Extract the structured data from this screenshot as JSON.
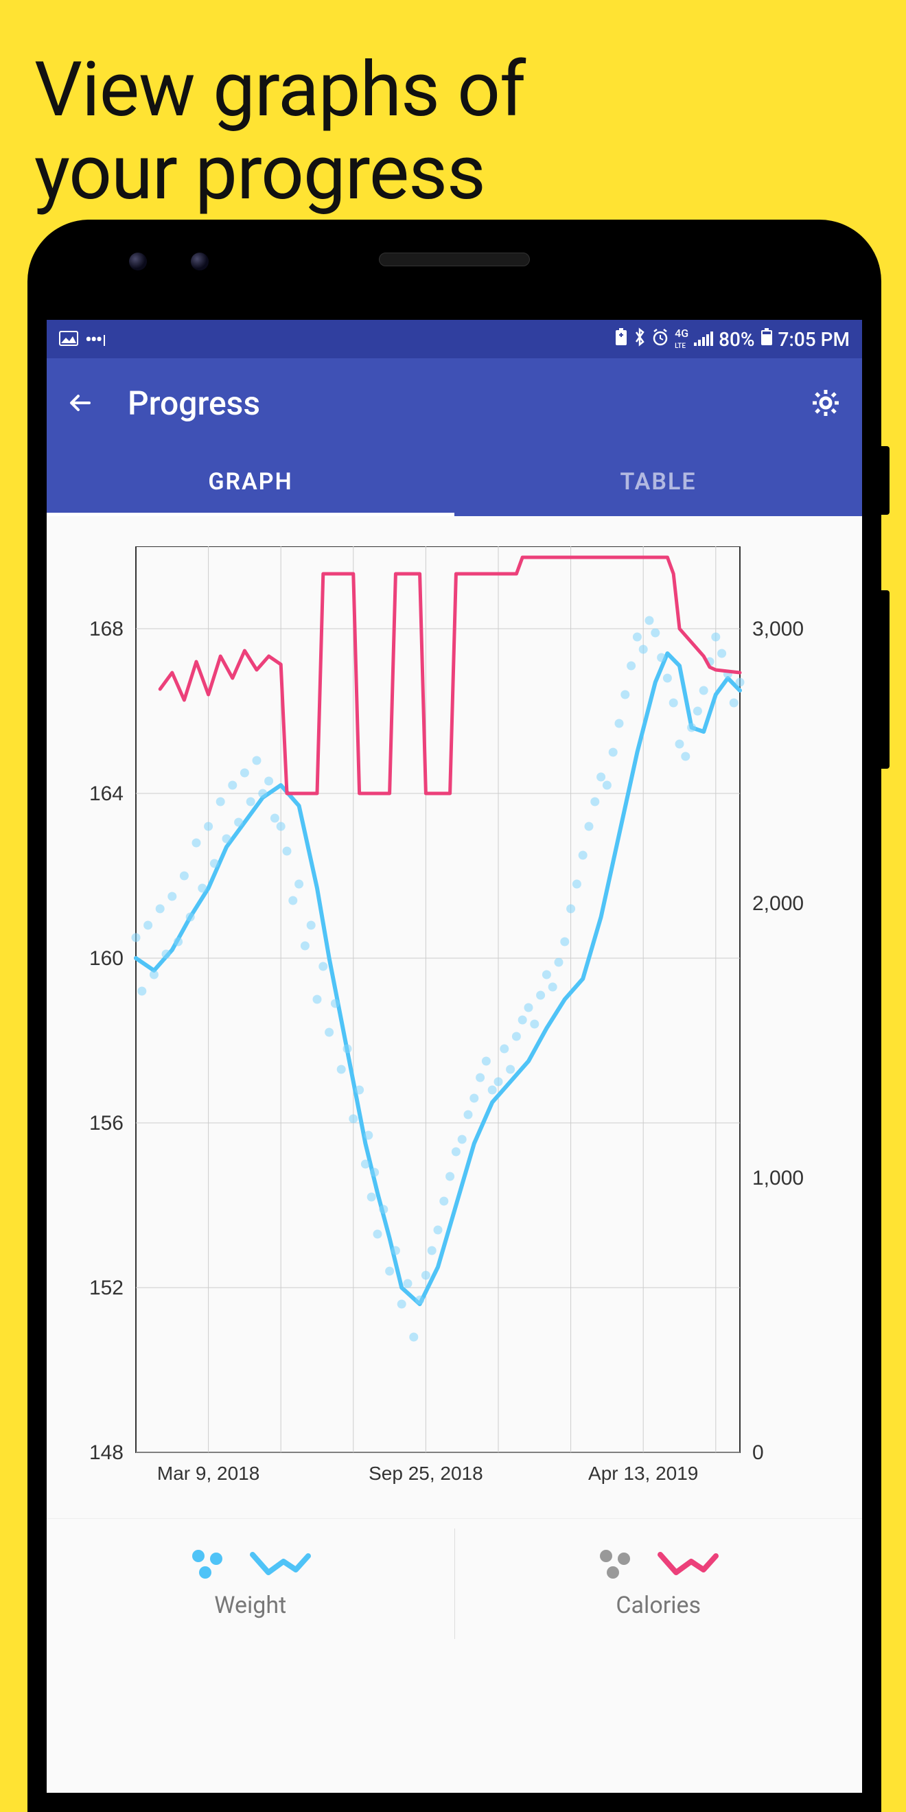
{
  "promo": {
    "line1": "View graphs of",
    "line2": "your progress"
  },
  "status_bar": {
    "battery_pct": "80%",
    "time": "7:05 PM"
  },
  "app_bar": {
    "title": "Progress"
  },
  "tabs": {
    "graph": "GRAPH",
    "table": "TABLE"
  },
  "legend": {
    "weight_label": "Weight",
    "calories_label": "Calories"
  },
  "chart_data": {
    "type": "line",
    "title": "",
    "x": {
      "label": "",
      "tick_labels": [
        "Mar 9, 2018",
        "Sep 25, 2018",
        "Apr 13, 2019"
      ],
      "tick_positions_pct": [
        12,
        48,
        84
      ]
    },
    "y_left": {
      "label": "",
      "ticks": [
        148,
        152,
        156,
        160,
        164,
        168
      ],
      "range": [
        148,
        170
      ]
    },
    "y_right": {
      "label": "",
      "ticks": [
        0,
        1000,
        2000,
        3000
      ],
      "range": [
        0,
        3300
      ],
      "tick_display": [
        "0",
        "1,000",
        "2,000",
        "3,000"
      ]
    },
    "series": [
      {
        "name": "Weight (trend line)",
        "axis": "left",
        "color": "#4fc3f7",
        "type": "line",
        "x_pct": [
          0,
          3,
          6,
          9,
          12,
          15,
          18,
          21,
          24,
          27,
          30,
          32,
          34,
          36,
          38,
          40,
          42,
          44,
          47,
          50,
          53,
          56,
          59,
          62,
          65,
          68,
          71,
          74,
          77,
          80,
          83,
          86,
          88,
          90,
          92,
          94,
          96,
          98,
          100
        ],
        "y": [
          160,
          159.7,
          160.2,
          161,
          161.7,
          162.7,
          163.3,
          163.9,
          164.2,
          163.7,
          161.7,
          160,
          158.5,
          157,
          155.5,
          154.3,
          153.2,
          152,
          151.6,
          152.5,
          154,
          155.5,
          156.5,
          157,
          157.5,
          158.3,
          159,
          159.5,
          161,
          163,
          165,
          166.7,
          167.4,
          167.1,
          165.6,
          165.5,
          166.4,
          166.8,
          166.5
        ]
      },
      {
        "name": "Weight (daily points)",
        "axis": "left",
        "color": "#81d4fa",
        "type": "scatter",
        "x_pct": [
          0,
          1,
          2,
          3,
          4,
          5,
          6,
          7,
          8,
          9,
          10,
          11,
          12,
          13,
          14,
          15,
          16,
          17,
          18,
          19,
          20,
          21,
          22,
          23,
          24,
          25,
          26,
          27,
          28,
          29,
          30,
          31,
          32,
          33,
          34,
          35,
          36,
          37,
          38,
          38.5,
          39,
          39.5,
          40,
          41,
          42,
          43,
          44,
          45,
          46,
          47,
          48,
          49,
          50,
          51,
          52,
          53,
          54,
          55,
          56,
          57,
          58,
          59,
          60,
          61,
          62,
          63,
          64,
          65,
          66,
          67,
          68,
          69,
          70,
          71,
          72,
          73,
          74,
          75,
          76,
          77,
          78,
          79,
          80,
          81,
          82,
          83,
          84,
          85,
          86,
          87,
          88,
          89,
          90,
          91,
          92,
          93,
          94,
          95,
          96,
          97,
          98,
          99,
          100
        ],
        "y": [
          160.5,
          159.2,
          160.8,
          159.6,
          161.2,
          160.1,
          161.5,
          160.4,
          162,
          161,
          162.8,
          161.7,
          163.2,
          162.3,
          163.8,
          162.9,
          164.2,
          163.3,
          164.5,
          163.8,
          164.8,
          164,
          164.3,
          163.4,
          163.2,
          162.6,
          161.4,
          161.8,
          160.3,
          160.8,
          159,
          159.8,
          158.2,
          158.9,
          157.3,
          157.8,
          156.1,
          156.8,
          155,
          155.7,
          154.2,
          154.8,
          153.3,
          153.9,
          152.4,
          152.9,
          151.6,
          152.1,
          150.8,
          151.7,
          152.3,
          152.9,
          153.4,
          154.1,
          154.7,
          155.3,
          155.6,
          156.2,
          156.6,
          157.1,
          157.5,
          156.8,
          157.0,
          157.8,
          157.3,
          158.1,
          158.5,
          158.8,
          158.4,
          159.1,
          159.6,
          159.3,
          159.9,
          160.4,
          161.2,
          161.8,
          162.5,
          163.2,
          163.8,
          164.4,
          164.2,
          165.0,
          165.7,
          166.4,
          167.1,
          167.8,
          167.5,
          168.2,
          167.9,
          167.3,
          166.8,
          166.2,
          165.2,
          164.9,
          165.6,
          166.0,
          166.5,
          167.2,
          167.8,
          167.4,
          166.9,
          166.2,
          166.7
        ]
      },
      {
        "name": "Calories",
        "axis": "right",
        "color": "#ec407a",
        "type": "line",
        "x_pct": [
          4,
          6,
          8,
          10,
          12,
          14,
          16,
          18,
          20,
          22,
          24,
          25,
          26,
          30,
          31,
          32,
          36,
          37,
          38,
          42,
          43,
          44,
          47,
          48,
          49,
          52,
          53,
          54,
          63,
          64,
          65,
          88,
          89,
          90,
          94,
          95,
          96,
          100
        ],
        "y": [
          2780,
          2840,
          2740,
          2880,
          2760,
          2900,
          2820,
          2920,
          2850,
          2900,
          2870,
          2400,
          2400,
          2400,
          3200,
          3200,
          3200,
          2400,
          2400,
          2400,
          3200,
          3200,
          3200,
          2400,
          2400,
          2400,
          3200,
          3200,
          3200,
          3260,
          3260,
          3260,
          3200,
          3000,
          2900,
          2860,
          2850,
          2840
        ]
      }
    ]
  }
}
